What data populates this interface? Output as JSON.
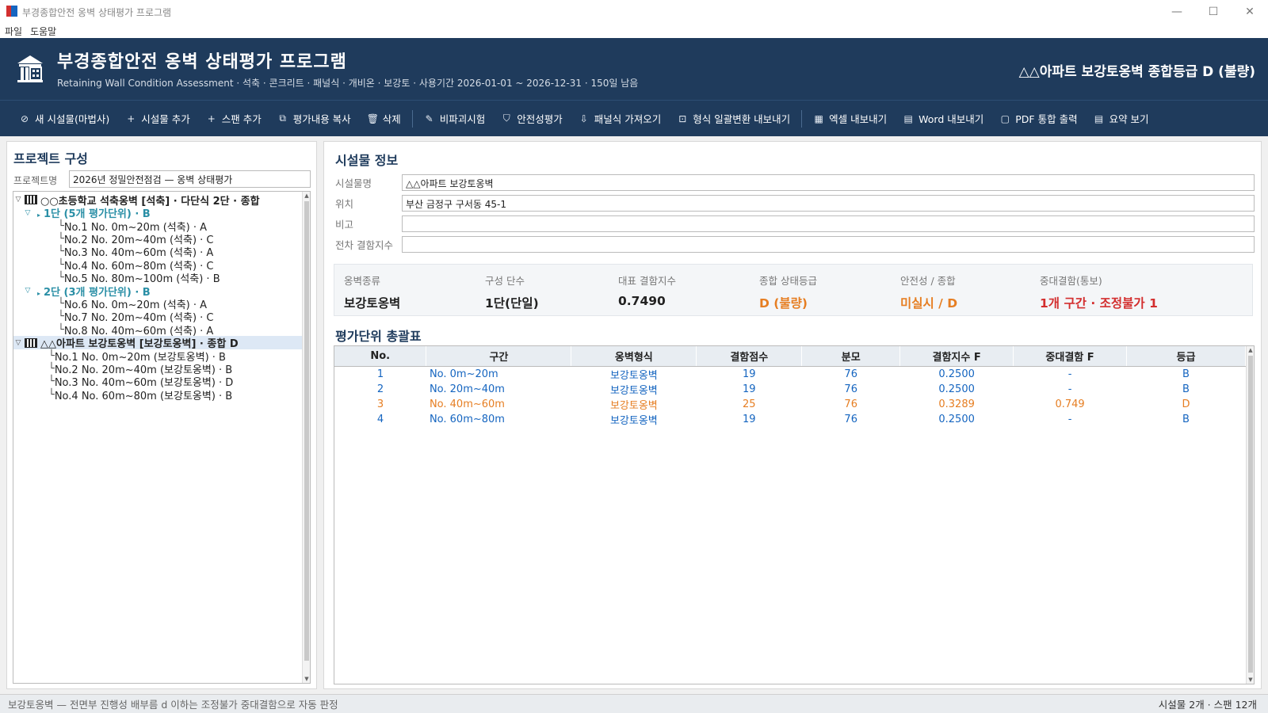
{
  "window": {
    "title": "부경종합안전 옹벽 상태평가 프로그램",
    "controls": {
      "minimize": "—",
      "maximize": "☐",
      "close": "✕"
    }
  },
  "menu": [
    "파일",
    "도움말"
  ],
  "header": {
    "title": "부경종합안전  옹벽 상태평가 프로그램",
    "subtitle_en": "Retaining Wall Condition Assessment",
    "types": "석축 · 콘크리트 · 패널식 · 개비온 · 보강토",
    "period": "사용기간 2026-01-01 ~ 2026-12-31",
    "days_left": "150일 남음",
    "grade_summary": "△△아파트 보강토옹벽 종합등급  D (불량)"
  },
  "toolbar": [
    {
      "icon": "⊘",
      "label": "새 시설물(마법사)",
      "name": "new-facility-button"
    },
    {
      "icon": "+",
      "label": "시설물 추가",
      "name": "add-facility-button"
    },
    {
      "icon": "+",
      "label": "스팬 추가",
      "name": "add-span-button"
    },
    {
      "icon": "⧉",
      "label": "평가내용 복사",
      "name": "copy-eval-button"
    },
    {
      "icon": "🗑",
      "label": "삭제",
      "name": "delete-button"
    },
    {
      "icon": "✎",
      "label": "비파괴시험",
      "name": "ndt-button"
    },
    {
      "icon": "⛉",
      "label": "안전성평가",
      "name": "safety-eval-button"
    },
    {
      "icon": "⇩",
      "label": "패널식 가져오기",
      "name": "panel-import-button"
    },
    {
      "icon": "⊡",
      "label": "형식 일괄변환 내보내기",
      "name": "batch-export-button"
    },
    {
      "icon": "▦",
      "label": "엑셀 내보내기",
      "name": "excel-export-button"
    },
    {
      "icon": "▤",
      "label": "Word 내보내기",
      "name": "word-export-button"
    },
    {
      "icon": "▢",
      "label": "PDF 통합 출력",
      "name": "pdf-export-button"
    },
    {
      "icon": "▤",
      "label": "요약 보기",
      "name": "summary-view-button"
    }
  ],
  "left": {
    "title": "프로젝트 구성",
    "project_label": "프로젝트명",
    "project_name": "2026년 정밀안전점검 — 옹벽 상태평가",
    "tree": [
      {
        "kind": "facility",
        "toggle": "▽",
        "text": "○○초등학교 석축옹벽 [석축] · 다단식 2단 · 종합",
        "selected": false
      },
      {
        "kind": "step",
        "toggle": "▽",
        "text": "1단 (5개 평가단위) · B"
      },
      {
        "kind": "leaf",
        "indent": 2,
        "text": "No.1 No. 0m~20m (석축) · A"
      },
      {
        "kind": "leaf",
        "indent": 2,
        "text": "No.2 No. 20m~40m (석축) · C"
      },
      {
        "kind": "leaf",
        "indent": 2,
        "text": "No.3 No. 40m~60m (석축) · A"
      },
      {
        "kind": "leaf",
        "indent": 2,
        "text": "No.4 No. 60m~80m (석축) · C"
      },
      {
        "kind": "leaf",
        "indent": 2,
        "text": "No.5 No. 80m~100m (석축) · B"
      },
      {
        "kind": "step",
        "toggle": "▽",
        "text": "2단 (3개 평가단위) · B"
      },
      {
        "kind": "leaf",
        "indent": 2,
        "text": "No.6 No. 0m~20m (석축) · A"
      },
      {
        "kind": "leaf",
        "indent": 2,
        "text": "No.7 No. 20m~40m (석축) · C"
      },
      {
        "kind": "leaf",
        "indent": 2,
        "text": "No.8 No. 40m~60m (석축) · A"
      },
      {
        "kind": "facility",
        "toggle": "▽",
        "text": "△△아파트 보강토옹벽 [보강토옹벽] · 종합 D",
        "selected": true
      },
      {
        "kind": "leaf",
        "indent": 1,
        "text": "No.1 No. 0m~20m (보강토옹벽) · B"
      },
      {
        "kind": "leaf",
        "indent": 1,
        "text": "No.2 No. 20m~40m (보강토옹벽) · B"
      },
      {
        "kind": "leaf",
        "indent": 1,
        "text": "No.3 No. 40m~60m (보강토옹벽) · D"
      },
      {
        "kind": "leaf",
        "indent": 1,
        "text": "No.4 No. 60m~80m (보강토옹벽) · B"
      }
    ]
  },
  "facility": {
    "title": "시설물 정보",
    "fields": [
      {
        "label": "시설물명",
        "value": "△△아파트 보강토옹벽"
      },
      {
        "label": "위치",
        "value": "부산 금정구 구서동 45-1"
      },
      {
        "label": "비고",
        "value": ""
      },
      {
        "label": "전차 결함지수",
        "value": ""
      }
    ]
  },
  "summary": [
    {
      "label": "옹벽종류",
      "value": "보강토옹벽",
      "color": ""
    },
    {
      "label": "구성 단수",
      "value": "1단(단일)",
      "color": ""
    },
    {
      "label": "대표 결함지수",
      "value": "0.7490",
      "color": ""
    },
    {
      "label": "종합 상태등급",
      "value": "D (불량)",
      "color": "orange"
    },
    {
      "label": "안전성 / 종합",
      "value": "미실시 / D",
      "color": "orange"
    },
    {
      "label": "중대결함(통보)",
      "value": "1개 구간 · 조정불가 1",
      "color": "red"
    }
  ],
  "table": {
    "title": "평가단위 총괄표",
    "headers": [
      "No.",
      "구간",
      "옹벽형식",
      "결함점수",
      "분모",
      "결함지수 F",
      "중대결함 F",
      "등급"
    ],
    "rows": [
      {
        "cells": [
          "1",
          "No. 0m~20m",
          "보강토옹벽",
          "19",
          "76",
          "0.2500",
          "-",
          "B"
        ],
        "warn": false
      },
      {
        "cells": [
          "2",
          "No. 20m~40m",
          "보강토옹벽",
          "19",
          "76",
          "0.2500",
          "-",
          "B"
        ],
        "warn": false
      },
      {
        "cells": [
          "3",
          "No. 40m~60m",
          "보강토옹벽",
          "25",
          "76",
          "0.3289",
          "0.749",
          "D"
        ],
        "warn": true
      },
      {
        "cells": [
          "4",
          "No. 60m~80m",
          "보강토옹벽",
          "19",
          "76",
          "0.2500",
          "-",
          "B"
        ],
        "warn": false
      }
    ]
  },
  "status": {
    "left": "보강토옹벽 — 전면부 진행성 배부름 d 이하는 조정불가 중대결함으로 자동 판정",
    "right": "시설물 2개 · 스팬 12개"
  }
}
